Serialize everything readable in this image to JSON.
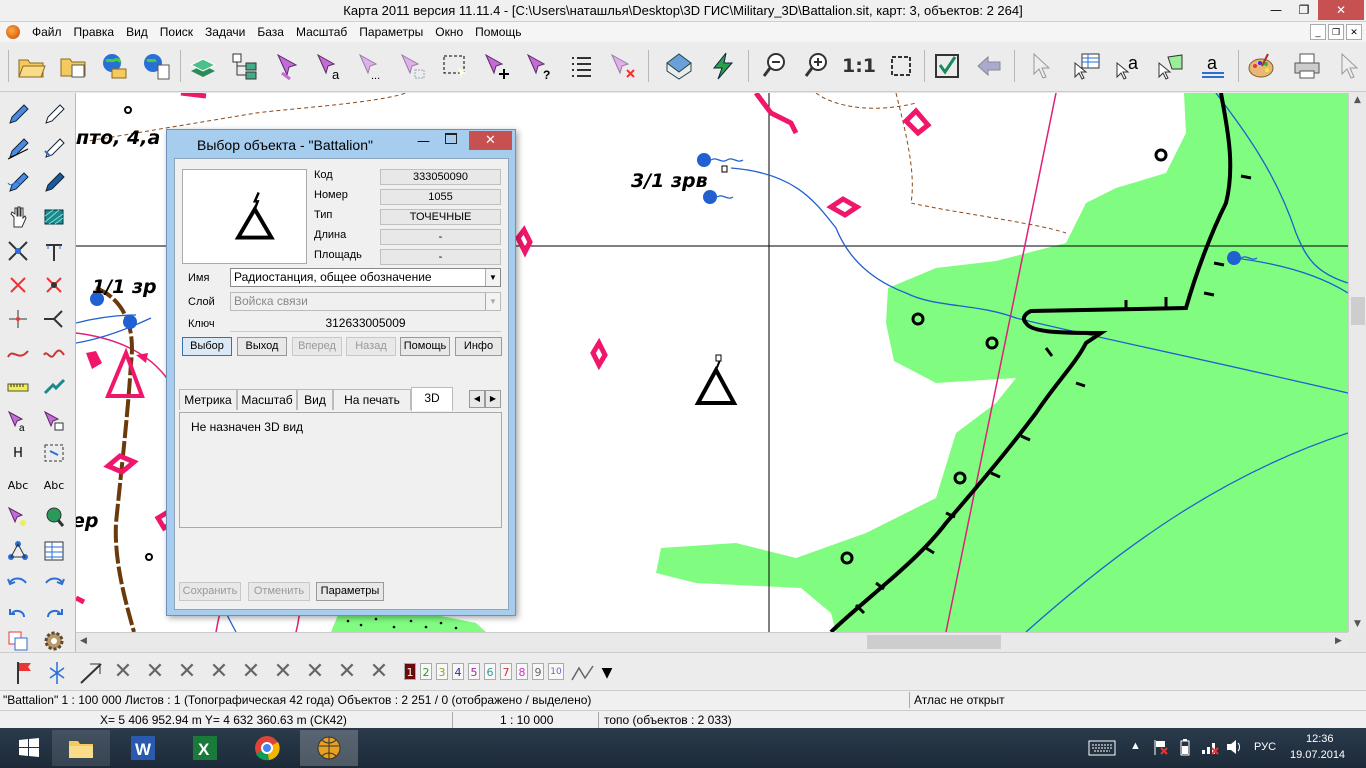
{
  "window": {
    "title": "Карта 2011 версия 11.11.4 - [C:\\Users\\наташлья\\Desktop\\3D ГИС\\Military_3D\\Battalion.sit, карт: 3, объектов: 2 264]",
    "minimize": "—",
    "maximize": "❐",
    "close": "✕"
  },
  "menu": {
    "items": [
      "Файл",
      "Правка",
      "Вид",
      "Поиск",
      "Задачи",
      "База",
      "Масштаб",
      "Параметры",
      "Окно",
      "Помощь"
    ]
  },
  "toolbar": {
    "scale_1_1": "1:1"
  },
  "lefttoolbar": {
    "h_label": "H",
    "abc1": "Abc",
    "abc2": "Abc"
  },
  "map": {
    "labels": [
      "пто, 4,а",
      "3/1 зрв",
      "1/1 зр",
      "ер"
    ]
  },
  "dialog": {
    "title": "Выбор объекта - \"Battalion\"",
    "fields": {
      "code_label": "Код",
      "code_value": "333050090",
      "number_label": "Номер",
      "number_value": "1055",
      "type_label": "Тип",
      "type_value": "ТОЧЕЧНЫЕ",
      "length_label": "Длина",
      "length_value": "-",
      "area_label": "Площадь",
      "area_value": "-"
    },
    "name_label": "Имя",
    "name_value": "Радиостанция, общее обозначение",
    "layer_label": "Слой",
    "layer_value": "Войска связи",
    "key_label": "Ключ",
    "key_value": "312633005009",
    "buttons": {
      "select": "Выбор",
      "exit": "Выход",
      "forward": "Вперед",
      "back": "Назад",
      "help": "Помощь",
      "info": "Инфо"
    },
    "tabs": [
      "Метрика",
      "Масштаб",
      "Вид",
      "На печать",
      "3D"
    ],
    "tab_content": "Не назначен 3D вид",
    "bottom_buttons": {
      "save": "Сохранить",
      "cancel": "Отменить",
      "params": "Параметры"
    }
  },
  "bottombar": {
    "numbers": [
      "1",
      "2",
      "3",
      "4",
      "5",
      "6",
      "7",
      "8",
      "9",
      "10"
    ]
  },
  "status": {
    "map_info": "\"Battalion\"  1 : 100 000   Листов : 1   (Топографическая 42 года)  Объектов : 2 251 / 0  (отображено / выделено)",
    "atlas": "Атлас не открыт",
    "coords": "X= 5 406 952.94 m     Y= 4 632 360.63 m  (СК42)",
    "scale": "1 : 10 000",
    "layer": "топо   (объектов : 2 033)"
  },
  "taskbar": {
    "lang": "РУС",
    "time": "12:36",
    "date": "19.07.2014"
  },
  "colors": {
    "green_area": "#80fd80",
    "pink_line": "#e0207a",
    "blue_line": "#2060d0",
    "brown_line": "#6b3a0a",
    "close_red": "#c75050"
  }
}
